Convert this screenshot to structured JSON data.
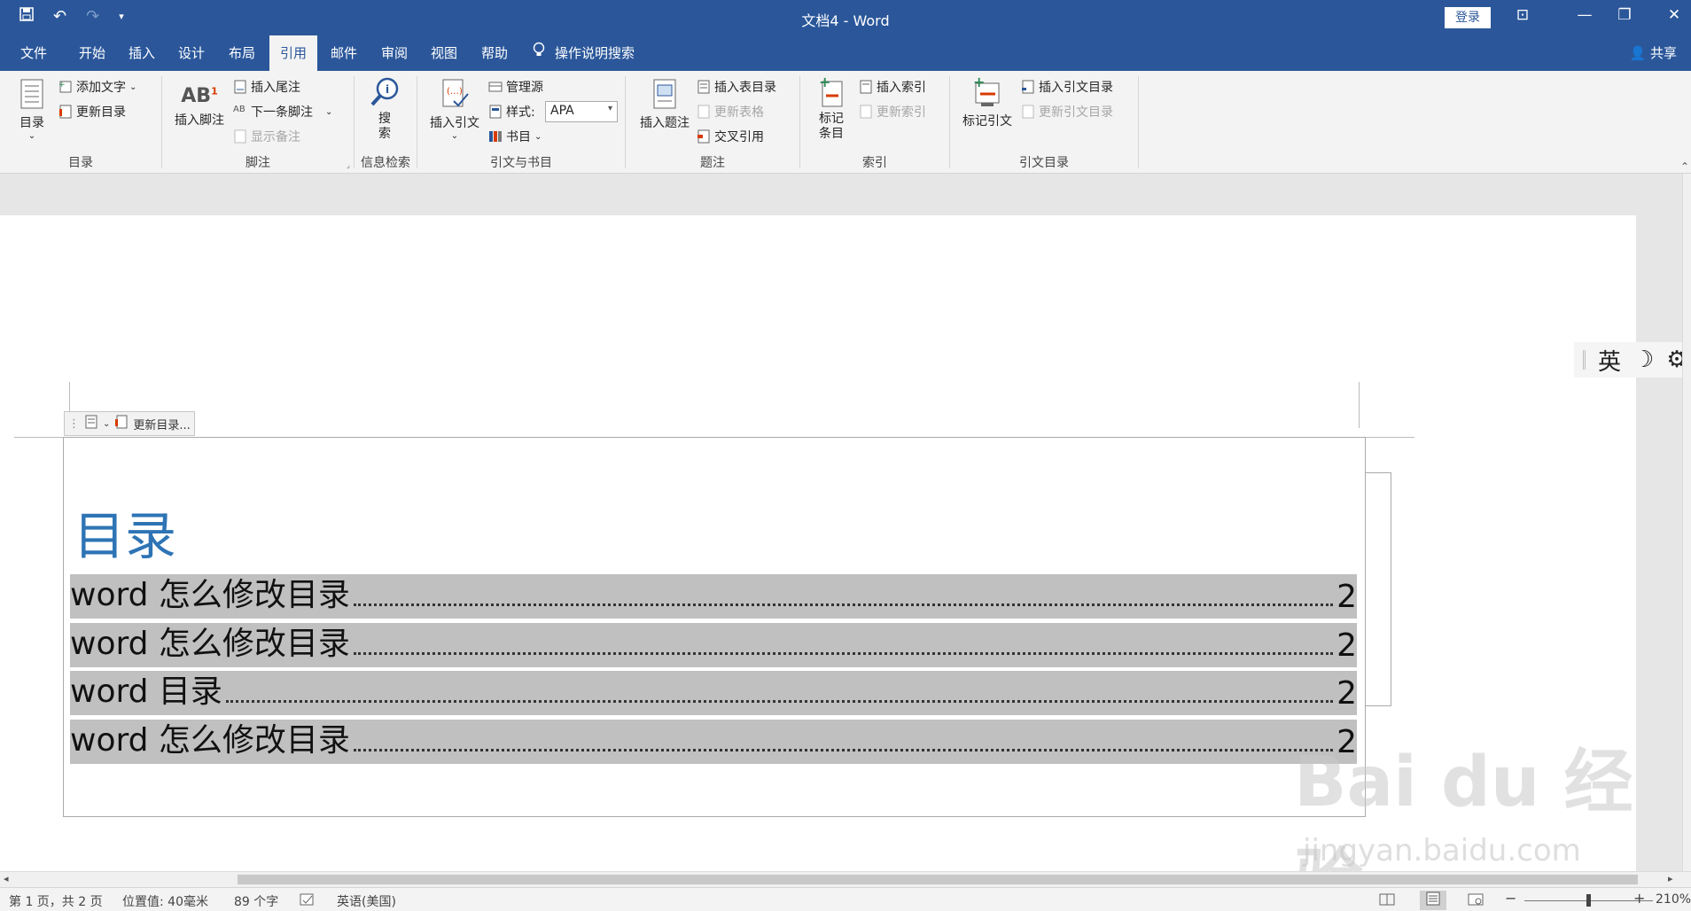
{
  "app": {
    "doc_title": "文档4  -  Word",
    "login_label": "登录",
    "share_label": "共享",
    "qat_undo": "↶",
    "qat_redo": "↷",
    "qat_more": "▾",
    "minimize": "—",
    "ribbon_display": "⊡",
    "restore": "❐",
    "close": "✕"
  },
  "tabs": [
    "文件",
    "开始",
    "插入",
    "设计",
    "布局",
    "引用",
    "邮件",
    "审阅",
    "视图",
    "帮助"
  ],
  "active_tab": "引用",
  "tell_me": "操作说明搜索",
  "ribbon": {
    "toc": {
      "label": "目录",
      "big": "目录",
      "add_text": "添加文字",
      "update": "更新目录"
    },
    "footnotes": {
      "label": "脚注",
      "insert_footnote": "插入脚注",
      "insert_endnote": "插入尾注",
      "next_footnote": "下一条脚注",
      "show_notes": "显示备注"
    },
    "research": {
      "label": "信息检索",
      "search": "搜\n索"
    },
    "citations": {
      "label": "引文与书目",
      "insert_citation": "插入引文",
      "manage_sources": "管理源",
      "style_label": "样式:",
      "style_value": "APA",
      "bibliography": "书目"
    },
    "captions": {
      "label": "题注",
      "insert_caption": "插入题注",
      "insert_table_of_figures": "插入表目录",
      "update_table": "更新表格",
      "cross_reference": "交叉引用"
    },
    "index": {
      "label": "索引",
      "mark_entry": "标记\n条目",
      "insert_index": "插入索引",
      "update_index": "更新索引"
    },
    "authorities": {
      "label": "引文目录",
      "mark_citation": "标记引文",
      "insert_toa": "插入引文目录",
      "update_toa": "更新引文目录"
    }
  },
  "ime": {
    "lang": "英",
    "moon": "☽",
    "gear": "⚙"
  },
  "toc_control": {
    "update_label": "更新目录..."
  },
  "document": {
    "toc_title": "目录",
    "entries": [
      {
        "text": "word 怎么修改目录",
        "page": "2"
      },
      {
        "text": "word 怎么修改目录",
        "page": "2"
      },
      {
        "text": "word 目录",
        "page": "2"
      },
      {
        "text": "word 怎么修改目录",
        "page": "2"
      }
    ]
  },
  "watermark": {
    "main": "Bai du 经验",
    "sub": "jingyan.baidu.com"
  },
  "status": {
    "pages": "第 1 页，共 2 页",
    "position": "位置值: 40毫米",
    "words": "89 个字",
    "language": "英语(美国)",
    "zoom": "210%",
    "zoom_minus": "−",
    "zoom_plus": "+"
  }
}
